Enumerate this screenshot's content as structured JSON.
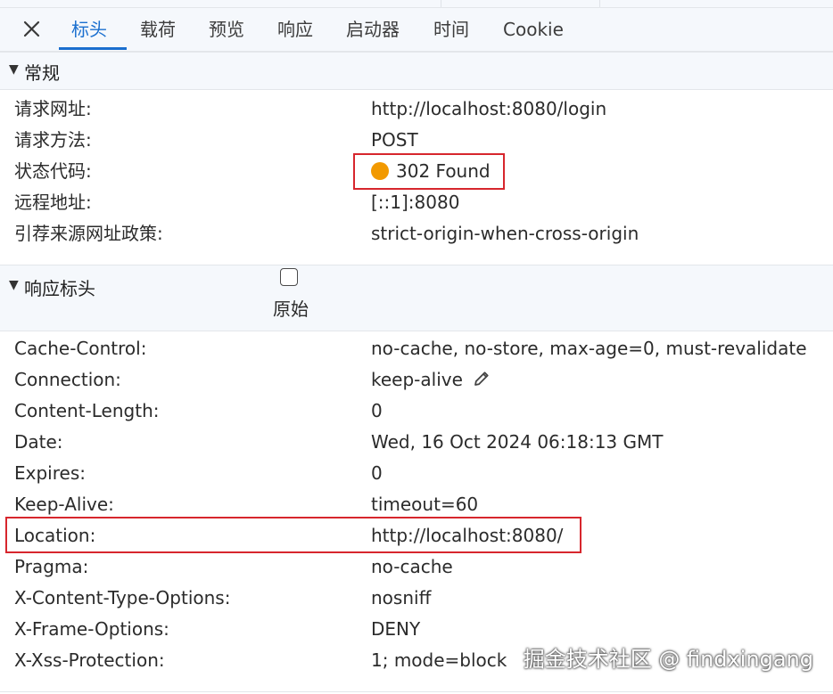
{
  "tabs": [
    {
      "label": "标头",
      "active": true
    },
    {
      "label": "载荷",
      "active": false
    },
    {
      "label": "预览",
      "active": false
    },
    {
      "label": "响应",
      "active": false
    },
    {
      "label": "启动器",
      "active": false
    },
    {
      "label": "时间",
      "active": false
    },
    {
      "label": "Cookie",
      "active": false
    }
  ],
  "general": {
    "title": "常规",
    "rows": [
      {
        "key": "请求网址:",
        "value": "http://localhost:8080/login"
      },
      {
        "key": "请求方法:",
        "value": "POST"
      },
      {
        "key": "状态代码:",
        "value": "302 Found"
      },
      {
        "key": "远程地址:",
        "value": "[::1]:8080"
      },
      {
        "key": "引荐来源网址政策:",
        "value": "strict-origin-when-cross-origin"
      }
    ]
  },
  "response_headers": {
    "title": "响应标头",
    "raw_label": "原始",
    "raw_checked": false,
    "rows": [
      {
        "key": "Cache-Control:",
        "value": "no-cache, no-store, max-age=0, must-revalidate"
      },
      {
        "key": "Connection:",
        "value": "keep-alive"
      },
      {
        "key": "Content-Length:",
        "value": "0"
      },
      {
        "key": "Date:",
        "value": "Wed, 16 Oct 2024 06:18:13 GMT"
      },
      {
        "key": "Expires:",
        "value": "0"
      },
      {
        "key": "Keep-Alive:",
        "value": "timeout=60"
      },
      {
        "key": "Location:",
        "value": "http://localhost:8080/"
      },
      {
        "key": "Pragma:",
        "value": "no-cache"
      },
      {
        "key": "X-Content-Type-Options:",
        "value": "nosniff"
      },
      {
        "key": "X-Frame-Options:",
        "value": "DENY"
      },
      {
        "key": "X-Xss-Protection:",
        "value": "1; mode=block"
      }
    ]
  },
  "watermark": "掘金技术社区 @ findxingang",
  "colors": {
    "accent": "#1a6fcf",
    "status_dot": "#f29900",
    "highlight": "#d7262d"
  }
}
